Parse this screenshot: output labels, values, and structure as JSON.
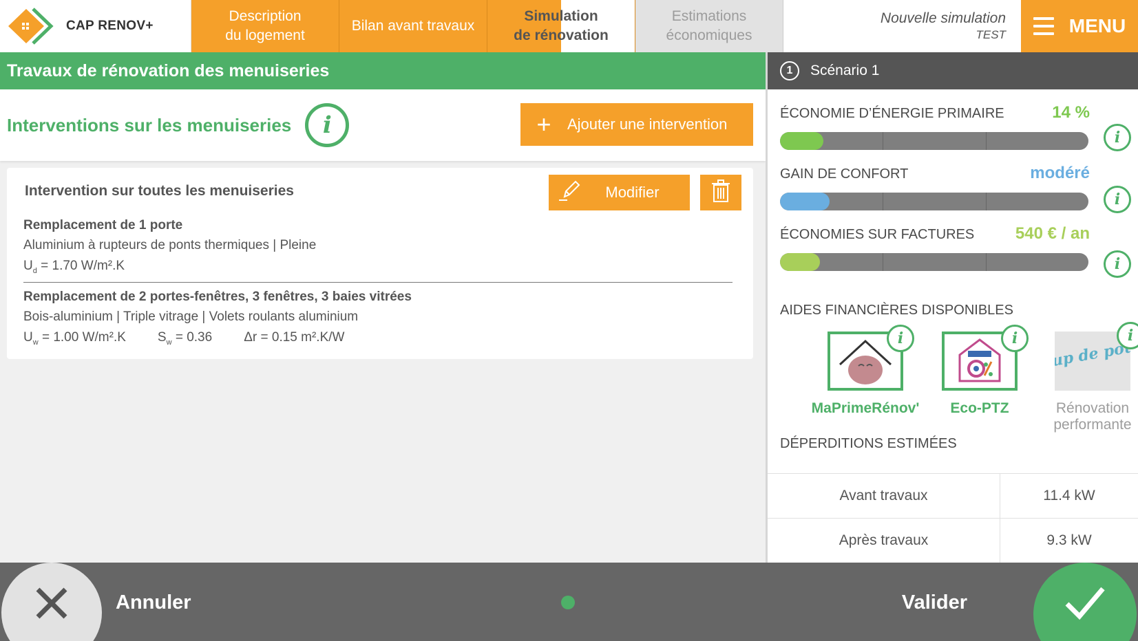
{
  "app": {
    "name": "CAP RENOV+"
  },
  "tabs": [
    {
      "line1": "Description",
      "line2": "du logement",
      "state": "done"
    },
    {
      "line1": "Bilan avant travaux",
      "line2": "",
      "state": "done"
    },
    {
      "line1": "Simulation",
      "line2": "de rénovation",
      "state": "active"
    },
    {
      "line1": "Estimations",
      "line2": "économiques",
      "state": "disabled"
    }
  ],
  "simulation": {
    "title": "Nouvelle simulation",
    "subtitle": "TEST"
  },
  "menu": {
    "label": "MENU"
  },
  "section": {
    "title": "Travaux de rénovation des menuiseries"
  },
  "interventions": {
    "title": "Interventions sur les menuiseries",
    "add_label": "Ajouter une intervention"
  },
  "card": {
    "title": "Intervention sur toutes les menuiseries",
    "modify_label": "Modifier",
    "items": [
      {
        "title": "Remplacement de 1 porte",
        "desc": "Aluminium à rupteurs de ponts thermiques | Pleine",
        "u_sym": "U",
        "u_sub": "d",
        "u_val": " =  1.70 W/m².K"
      },
      {
        "title": "Remplacement de 2 portes-fenêtres, 3 fenêtres, 3 baies vitrées",
        "desc": "Bois-aluminium | Triple vitrage | Volets roulants aluminium",
        "u_sym": "U",
        "u_sub": "w",
        "u_val": " =  1.00 W/m².K",
        "s_sym": "S",
        "s_sub": "w",
        "s_val": " =  0.36",
        "r_val": "Δr = 0.15 m².K/W"
      }
    ]
  },
  "scenario": {
    "number": "1",
    "label": "Scénario 1"
  },
  "metrics": [
    {
      "label": "ÉCONOMIE D’ÉNERGIE PRIMAIRE",
      "value": "14 %",
      "level": 0.14,
      "color": "#7ec850",
      "value_color": "#7ec850"
    },
    {
      "label": "GAIN DE CONFORT",
      "value": "modéré",
      "level": 0.16,
      "color": "#6aaee0",
      "value_color": "#6aaee0"
    },
    {
      "label": "ÉCONOMIES SUR FACTURES",
      "value": "540 € / an",
      "level": 0.13,
      "color": "#a8cf5a",
      "value_color": "#a8cf5a"
    }
  ],
  "aides": {
    "title": "AIDES FINANCIÈRES DISPONIBLES",
    "items": [
      {
        "name": "MaPrimeRénov'",
        "available": true
      },
      {
        "name": "Eco-PTZ",
        "available": true
      },
      {
        "name": "Rénovation performante",
        "logo_text": "Coup de pouce",
        "available": false
      }
    ]
  },
  "deperditions": {
    "title": "DÉPERDITIONS ESTIMÉES",
    "rows": [
      {
        "label": "Avant travaux",
        "value": "11.4 kW"
      },
      {
        "label": "Après travaux",
        "value": "9.3 kW"
      }
    ]
  },
  "footer": {
    "cancel_label": "Annuler",
    "validate_label": "Valider"
  },
  "colors": {
    "orange": "#f5a02a",
    "green": "#4eb068",
    "dark": "#555555"
  }
}
